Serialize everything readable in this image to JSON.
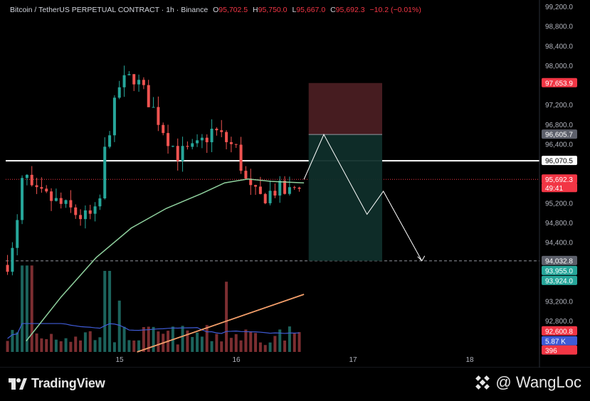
{
  "header": {
    "symbol": "Bitcoin / TetherUS PERPETUAL CONTRACT · 1h · Binance",
    "o_label": "O",
    "o_value": "95,702.5",
    "h_label": "H",
    "h_value": "95,750.0",
    "l_label": "L",
    "l_value": "95,667.0",
    "c_label": "C",
    "c_value": "95,692.3",
    "change": "−10.2 (−0.01%)"
  },
  "footer": {
    "brand": "TradingView",
    "watermark": "@ WangLoc"
  },
  "colors": {
    "up": "#26a69a",
    "down": "#ef5350",
    "ma_fast": "#8fd19e",
    "ma_slow": "#f5a06b",
    "volume_ma": "#3f5bd6",
    "stop_zone": "#4a1e22",
    "target_zone": "#0f2e2a"
  },
  "chart_data": {
    "type": "candlestick",
    "price_axis_ticks": [
      "99,200.0",
      "98,800.0",
      "98,400.0",
      "98,000.0",
      "97,200.0",
      "96,800.0",
      "96,400.0",
      "95,200.0",
      "94,800.0",
      "94,400.0",
      "93,200.0",
      "92,800.0"
    ],
    "time_axis_labels": [
      "15",
      "16",
      "17",
      "18"
    ],
    "price_labels": [
      {
        "text": "97,653.9",
        "color": "#f23645"
      },
      {
        "text": "96,605.7",
        "color": "#5d606b"
      },
      {
        "text": "96,070.5",
        "color": "#ffffff"
      },
      {
        "text": "95,692.3",
        "color": "#f23645"
      },
      {
        "text": "49:41",
        "color": "#f23645"
      },
      {
        "text": "94,032.8",
        "color": "#5d606b"
      },
      {
        "text": "93,955.0",
        "color": "#26a69a"
      },
      {
        "text": "93,924.0",
        "color": "#26a69a"
      },
      {
        "text": "92,600.8",
        "color": "#f23645"
      },
      {
        "text": "5.87 K",
        "color": "#3f5bd6"
      },
      {
        "text": "396",
        "color": "#f23645"
      }
    ],
    "horizontal_levels": [
      {
        "price": 96070.5,
        "style": "solid",
        "color": "#ffffff"
      },
      {
        "price": 94032.8,
        "style": "dashed",
        "color": "#9598a1"
      },
      {
        "price": 95692.3,
        "style": "dotted",
        "color": "#f23645"
      }
    ],
    "position_tool": {
      "entry": 96605.7,
      "stop": 97653.9,
      "target": 94032.8
    },
    "projection_path": [
      {
        "t": 16.58,
        "price": 95692.3
      },
      {
        "t": 16.75,
        "price": 96605.7
      },
      {
        "t": 17.12,
        "price": 94980
      },
      {
        "t": 17.26,
        "price": 95450
      },
      {
        "t": 17.59,
        "price": 94032.8
      }
    ],
    "y_range": [
      92450,
      99300
    ],
    "x_range": [
      14.0,
      19.1
    ]
  }
}
